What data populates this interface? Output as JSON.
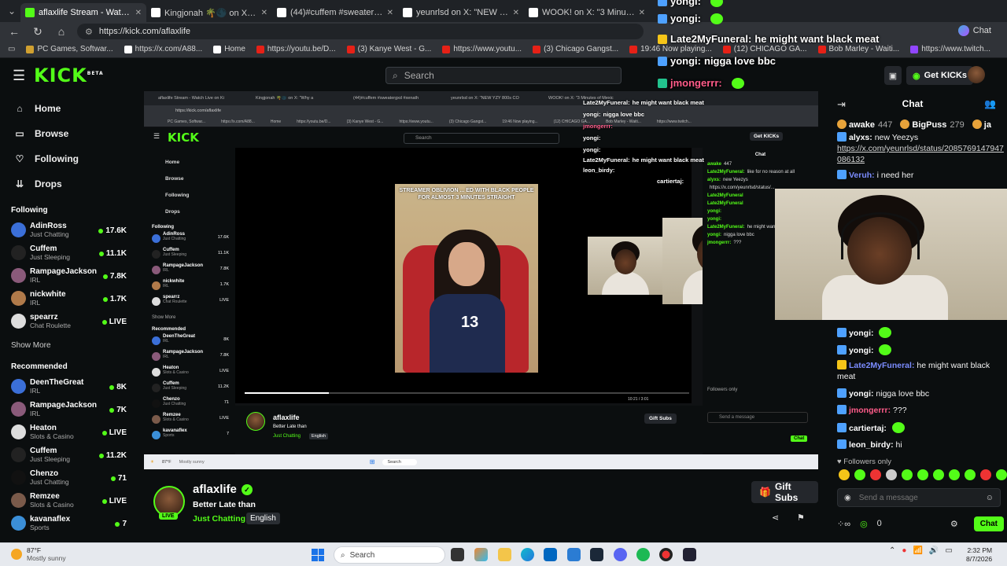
{
  "browser": {
    "tabs": [
      {
        "label": "aflaxlife Stream - Watch Live on Ki",
        "fav": "#53fc18",
        "active": true
      },
      {
        "label": "Kingjonah 🌴🌑 on X: \"Why a",
        "fav": "#ffffff",
        "active": false
      },
      {
        "label": "(44)#cuffem #sweatergxd #xenath",
        "fav": "#ffffff",
        "active": false
      },
      {
        "label": "yeunrlsd on X: \"NEW YZY 800s CO",
        "fav": "#ffffff",
        "active": false
      },
      {
        "label": "WOOK! on X: \"3 Minutes of Mexic",
        "fav": "#ffffff",
        "active": false
      }
    ],
    "url": "https://kick.com/aflaxlife",
    "extension_label": "Chat",
    "bookmarks": [
      {
        "label": "PC Games, Softwar...",
        "color": "#d0a030"
      },
      {
        "label": "https://x.com/A88...",
        "color": "#ffffff"
      },
      {
        "label": "Home",
        "color": "#ffffff"
      },
      {
        "label": "https://youtu.be/D...",
        "color": "#e62117"
      },
      {
        "label": "(3) Kanye West - G...",
        "color": "#e62117"
      },
      {
        "label": "https://www.youtu...",
        "color": "#e62117"
      },
      {
        "label": "(3) Chicago Gangst...",
        "color": "#e62117"
      },
      {
        "label": "19:46 Now playing...",
        "color": "#e62117"
      },
      {
        "label": "(12) CHICAGO GA...",
        "color": "#e62117"
      },
      {
        "label": "Bob Marley - Waiti...",
        "color": "#e62117"
      },
      {
        "label": "https://www.twitch...",
        "color": "#9146ff"
      }
    ]
  },
  "kick": {
    "logo": "KICK",
    "logo_sup": "BETA",
    "search_placeholder": "Search",
    "get_kicks": "Get KICKs",
    "accent": "#53fc18"
  },
  "sidebar": {
    "nav": [
      {
        "label": "Home",
        "icon": "home-icon",
        "glyph": "⌂"
      },
      {
        "label": "Browse",
        "icon": "browse-icon",
        "glyph": "▭"
      },
      {
        "label": "Following",
        "icon": "heart-icon",
        "glyph": "♡"
      },
      {
        "label": "Drops",
        "icon": "drops-icon",
        "glyph": "⇊"
      }
    ],
    "following_title": "Following",
    "following": [
      {
        "name": "AdinRoss",
        "category": "Just Chatting",
        "viewers": "17.6K",
        "color": "#3b6fd8"
      },
      {
        "name": "Cuffem",
        "category": "Just Sleeping",
        "viewers": "11.1K",
        "color": "#222222"
      },
      {
        "name": "RampageJackson",
        "category": "IRL",
        "viewers": "7.8K",
        "color": "#8a5a7a"
      },
      {
        "name": "nickwhite",
        "category": "IRL",
        "viewers": "1.7K",
        "color": "#b07a4a"
      },
      {
        "name": "spearrz",
        "category": "Chat Roulette",
        "viewers": "LIVE",
        "color": "#dddddd"
      }
    ],
    "show_more": "Show More",
    "recommended_title": "Recommended",
    "recommended": [
      {
        "name": "DeenTheGreat",
        "category": "IRL",
        "viewers": "8K",
        "color": "#3b6fd8"
      },
      {
        "name": "RampageJackson",
        "category": "IRL",
        "viewers": "7K",
        "color": "#8a5a7a"
      },
      {
        "name": "Heaton",
        "category": "Slots & Casino",
        "viewers": "LIVE",
        "color": "#dddddd"
      },
      {
        "name": "Cuffem",
        "category": "Just Sleeping",
        "viewers": "11.2K",
        "color": "#222222"
      },
      {
        "name": "Chenzo",
        "category": "Just Chatting",
        "viewers": "71",
        "color": "#111111"
      },
      {
        "name": "Remzee",
        "category": "Slots & Casino",
        "viewers": "LIVE",
        "color": "#7a5a4a"
      },
      {
        "name": "kavanaflex",
        "category": "Sports",
        "viewers": "7",
        "color": "#3b8fd8"
      }
    ]
  },
  "inner": {
    "tabs": [
      "aflaxlife Stream - Watch Live on Ki",
      "Kingjonah 🌴🌑 on X: \"Why a",
      "(44)#cuffem #sweatergxd #xenath",
      "yeunrlsd on X: \"NEW YZY 800s CO",
      "WOOK! on X: \"3 Minutes of Mexic"
    ],
    "url": "https://kick.com/aflaxlife",
    "bookmarks": [
      "PC Games, Softwar...",
      "https://x.com/A88...",
      "Home",
      "https://youtu.be/D...",
      "(3) Kanye West - G...",
      "https://www.youtu...",
      "(3) Chicago Gangst...",
      "19:46 Now playing...",
      "(12) CHICAGO GA...",
      "Bob Marley - Waiti...",
      "https://www.twitch..."
    ],
    "logo": "KICK",
    "search_placeholder": "Search",
    "get_kicks": "Get KICKs",
    "nav": [
      "Home",
      "Browse",
      "Following",
      "Drops"
    ],
    "following_title": "Following",
    "following": [
      {
        "name": "AdinRoss",
        "category": "Just Chatting",
        "viewers": "17.6K",
        "color": "#3b6fd8"
      },
      {
        "name": "Cuffem",
        "category": "Just Sleeping",
        "viewers": "11.1K",
        "color": "#222222"
      },
      {
        "name": "RampageJackson",
        "category": "IRL",
        "viewers": "7.8K",
        "color": "#8a5a7a"
      },
      {
        "name": "nickwhite",
        "category": "IRL",
        "viewers": "1.7K",
        "color": "#b07a4a"
      },
      {
        "name": "spearrz",
        "category": "Chat Roulette",
        "viewers": "LIVE",
        "color": "#dddddd"
      }
    ],
    "show_more": "Show More",
    "recommended_title": "Recommended",
    "recommended": [
      {
        "name": "DeenTheGreat",
        "category": "IRL",
        "viewers": "8K",
        "color": "#3b6fd8"
      },
      {
        "name": "RampageJackson",
        "category": "IRL",
        "viewers": "7.8K",
        "color": "#8a5a7a"
      },
      {
        "name": "Heaton",
        "category": "Slots & Casino",
        "viewers": "LIVE",
        "color": "#dddddd"
      },
      {
        "name": "Cuffem",
        "category": "Just Sleeping",
        "viewers": "11.2K",
        "color": "#222222"
      },
      {
        "name": "Chenzo",
        "category": "Just Chatting",
        "viewers": "71",
        "color": "#111111"
      },
      {
        "name": "Remzee",
        "category": "Slots & Casino",
        "viewers": "LIVE",
        "color": "#7a5a4a"
      },
      {
        "name": "kavanaflex",
        "category": "Sports",
        "viewers": "7",
        "color": "#3b8fd8"
      }
    ],
    "video_caption": "STREAMER OBLIVION ... ED WITH BLACK PEOPLE FOR ALMOST 3 MINUTES STRAIGHT",
    "shirt_number": "13",
    "video_time": "10:21 / 3:01",
    "progress": 0.19,
    "streamer_name": "aflaxlife",
    "stream_title": "Better Late than",
    "category": "Just Chatting",
    "language": "English",
    "gift_subs": "Gift Subs",
    "chat_title": "Chat",
    "chat_lines": [
      {
        "user": "awake",
        "text": "447"
      },
      {
        "user": "Late2MyFuneral:",
        "text": "like for no reason at all"
      },
      {
        "user": "alyxs:",
        "text": "new Yeezys"
      },
      {
        "user": "",
        "text": "https://x.com/yeunrlsd/status/..."
      },
      {
        "user": "Late2MyFuneral",
        "text": ""
      },
      {
        "user": "Late2MyFuneral",
        "text": ""
      },
      {
        "user": "yongi:",
        "text": ""
      },
      {
        "user": "yongi:",
        "text": ""
      },
      {
        "user": "Late2MyFuneral:",
        "text": "he might want black meat"
      },
      {
        "user": "yongi:",
        "text": "nigga love bbc"
      },
      {
        "user": "jmongerrr:",
        "text": "???"
      }
    ],
    "followers_only": "Followers only",
    "send_placeholder": "Send a message",
    "chat_button": "Chat",
    "taskbar_search": "Search",
    "weather_temp": "87°F",
    "weather_desc": "Mostly sunny",
    "overlay_lines": [
      {
        "user": "Late2MyFuneral:",
        "text": "he might want black meat"
      },
      {
        "user": "yongi:",
        "text": "nigga love bbc"
      },
      {
        "user": "jmongerrr:",
        "text": ""
      },
      {
        "user": "yongi:",
        "text": ""
      },
      {
        "user": "yongi:",
        "text": ""
      },
      {
        "user": "Late2MyFuneral:",
        "text": "he might want black meat"
      },
      {
        "user": "leon_birdy:",
        "text": ""
      },
      {
        "user": "cartiertaj:",
        "text": ""
      }
    ]
  },
  "overlay_chat": [
    {
      "user": "yongi:",
      "text": ""
    },
    {
      "user": "yongi:",
      "text": ""
    },
    {
      "user": "Late2MyFuneral:",
      "text": "he might want black meat"
    },
    {
      "user": "yongi:",
      "text": "nigga love bbc"
    },
    {
      "user": "jmongerrr:",
      "text": ""
    }
  ],
  "chat": {
    "title": "Chat",
    "pinned": [
      {
        "user": "awake",
        "count": "447"
      },
      {
        "user": "BigPuss",
        "count": "279"
      },
      {
        "user": "ja",
        "count": ""
      }
    ],
    "messages": [
      {
        "user": "alyxs:",
        "text": "new Yeezys",
        "color": "#ffffff"
      },
      {
        "user": "",
        "text": "https://x.com/yeunrlsd/status/2085769147947086132",
        "color": "#ffffff",
        "link": true
      },
      {
        "user": "Veruh:",
        "text": "i need her",
        "color": "#7b8cff"
      },
      {
        "user": "yongi:",
        "text": "",
        "color": "#ffffff"
      },
      {
        "user": "yongi:",
        "text": "",
        "color": "#ffffff"
      },
      {
        "user": "Late2MyFuneral:",
        "text": "he might want black meat",
        "color": "#7b8cff"
      },
      {
        "user": "yongi:",
        "text": "nigga love bbc",
        "color": "#ffffff"
      },
      {
        "user": "jmongerrr:",
        "text": "???",
        "color": "#ff5c8a"
      },
      {
        "user": "cartiertaj:",
        "text": "",
        "color": "#ffffff"
      },
      {
        "user": "leon_birdy:",
        "text": "hi",
        "color": "#ffffff"
      }
    ],
    "followers_only": "Followers only",
    "send_placeholder": "Send a message",
    "points": "0",
    "send_button": "Chat"
  },
  "streamer": {
    "name": "aflaxlife",
    "live_badge": "LIVE",
    "title": "Better Late than",
    "category": "Just Chatting",
    "language": "English",
    "gift_subs": "Gift Subs"
  },
  "taskbar": {
    "weather_temp": "87°F",
    "weather_desc": "Mostly sunny",
    "search_placeholder": "Search",
    "time": "2:32 PM",
    "date": "8/7/2026"
  }
}
